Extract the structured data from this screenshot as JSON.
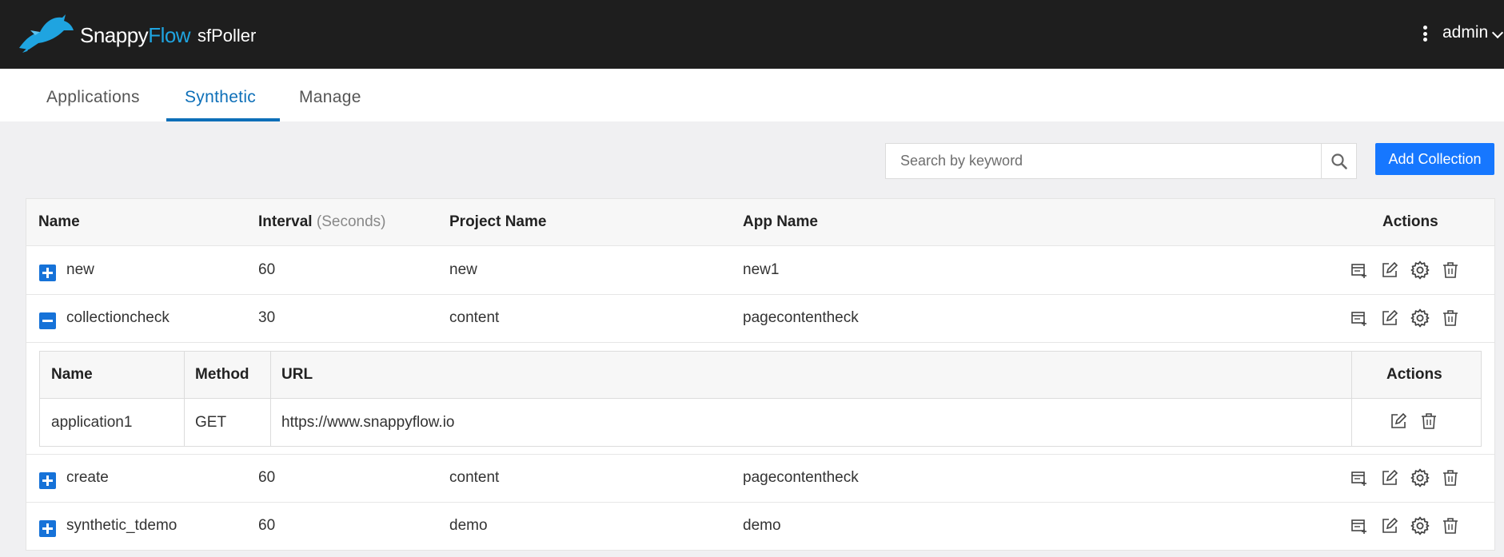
{
  "header": {
    "brand_main": "Snappy",
    "brand_accent": "Flow",
    "product": "sfPoller",
    "user": "admin"
  },
  "tabs": [
    {
      "label": "Applications",
      "active": false
    },
    {
      "label": "Synthetic",
      "active": true
    },
    {
      "label": "Manage",
      "active": false
    }
  ],
  "search": {
    "placeholder": "Search by keyword",
    "value": ""
  },
  "add_button": "Add Collection",
  "table": {
    "columns": {
      "name": "Name",
      "interval": "Interval",
      "interval_unit": "(Seconds)",
      "project": "Project Name",
      "app": "App Name",
      "actions": "Actions"
    },
    "rows": [
      {
        "name": "new",
        "interval": "60",
        "project": "new",
        "app": "new1",
        "expanded": false
      },
      {
        "name": "collectioncheck",
        "interval": "30",
        "project": "content",
        "app": "pagecontentheck",
        "expanded": true
      },
      {
        "name": "create",
        "interval": "60",
        "project": "content",
        "app": "pagecontentheck",
        "expanded": false
      },
      {
        "name": "synthetic_tdemo",
        "interval": "60",
        "project": "demo",
        "app": "demo",
        "expanded": false
      }
    ]
  },
  "subtable": {
    "columns": {
      "name": "Name",
      "method": "Method",
      "url": "URL",
      "actions": "Actions"
    },
    "rows": [
      {
        "name": "application1",
        "method": "GET",
        "url": "https://www.snappyflow.io"
      }
    ]
  },
  "colors": {
    "header_bg": "#1e1e1e",
    "accent": "#0d6fb8",
    "button": "#1677ff",
    "brand_flow": "#1fa4e0"
  }
}
